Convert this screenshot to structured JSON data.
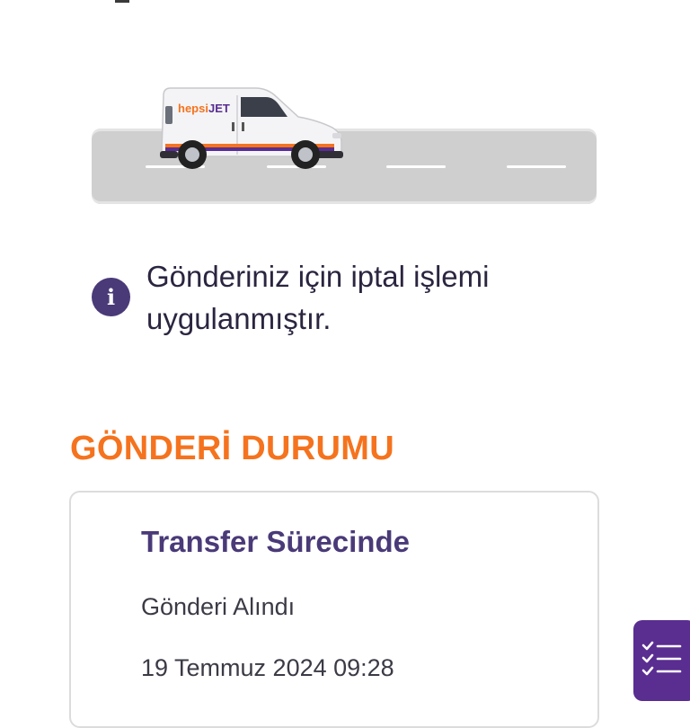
{
  "hero": {
    "van_brand_a": "hepsi",
    "van_brand_b": "JET",
    "van_icon": "delivery-van-icon",
    "road_icon": "road-illustration"
  },
  "notice": {
    "icon": "info-icon",
    "icon_glyph": "i",
    "message": "Gönderiniz için iptal işlemi uygulanmıştır."
  },
  "section": {
    "title": "GÖNDERİ DURUMU"
  },
  "status": {
    "title": "Transfer Sürecinde",
    "subtitle": "Gönderi Alındı",
    "datetime": "19 Temmuz 2024 09:28"
  },
  "fab": {
    "icon": "checklist-icon"
  },
  "colors": {
    "accent_orange": "#f5731e",
    "brand_purple": "#4a3a78",
    "fab_purple": "#5a2d91"
  }
}
